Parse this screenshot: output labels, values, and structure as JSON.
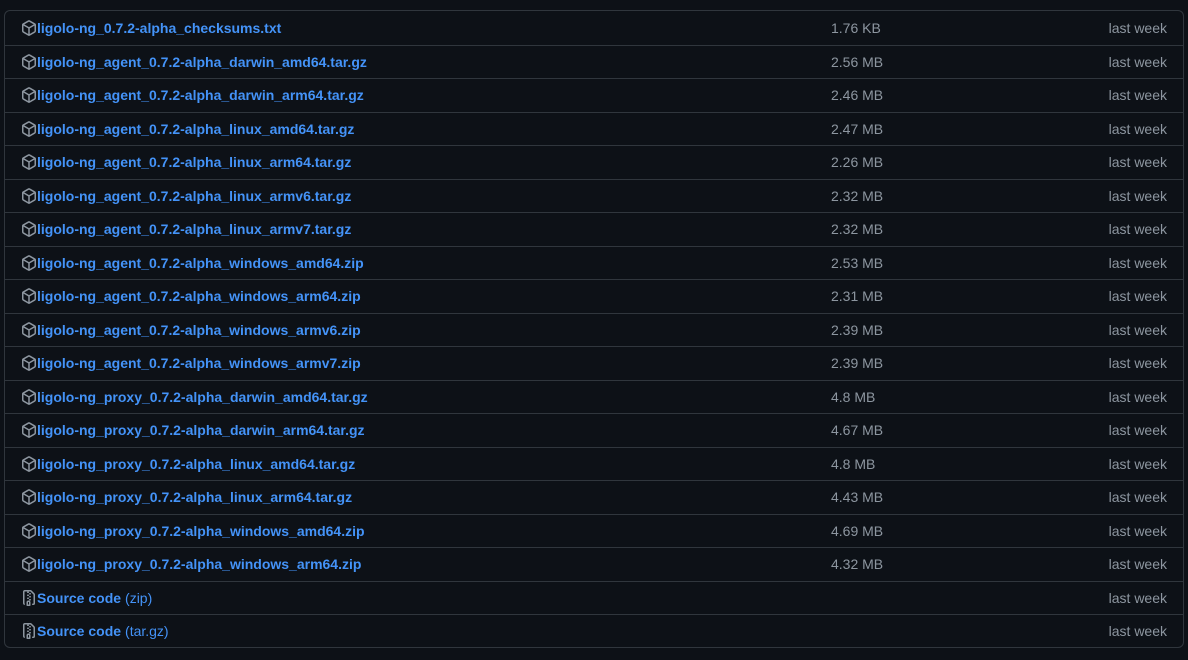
{
  "assets": [
    {
      "name": "ligolo-ng_0.7.2-alpha_checksums.txt",
      "size": "1.76 KB",
      "date": "last week",
      "icon": "package-icon"
    },
    {
      "name": "ligolo-ng_agent_0.7.2-alpha_darwin_amd64.tar.gz",
      "size": "2.56 MB",
      "date": "last week",
      "icon": "package-icon"
    },
    {
      "name": "ligolo-ng_agent_0.7.2-alpha_darwin_arm64.tar.gz",
      "size": "2.46 MB",
      "date": "last week",
      "icon": "package-icon"
    },
    {
      "name": "ligolo-ng_agent_0.7.2-alpha_linux_amd64.tar.gz",
      "size": "2.47 MB",
      "date": "last week",
      "icon": "package-icon"
    },
    {
      "name": "ligolo-ng_agent_0.7.2-alpha_linux_arm64.tar.gz",
      "size": "2.26 MB",
      "date": "last week",
      "icon": "package-icon"
    },
    {
      "name": "ligolo-ng_agent_0.7.2-alpha_linux_armv6.tar.gz",
      "size": "2.32 MB",
      "date": "last week",
      "icon": "package-icon"
    },
    {
      "name": "ligolo-ng_agent_0.7.2-alpha_linux_armv7.tar.gz",
      "size": "2.32 MB",
      "date": "last week",
      "icon": "package-icon"
    },
    {
      "name": "ligolo-ng_agent_0.7.2-alpha_windows_amd64.zip",
      "size": "2.53 MB",
      "date": "last week",
      "icon": "package-icon"
    },
    {
      "name": "ligolo-ng_agent_0.7.2-alpha_windows_arm64.zip",
      "size": "2.31 MB",
      "date": "last week",
      "icon": "package-icon"
    },
    {
      "name": "ligolo-ng_agent_0.7.2-alpha_windows_armv6.zip",
      "size": "2.39 MB",
      "date": "last week",
      "icon": "package-icon"
    },
    {
      "name": "ligolo-ng_agent_0.7.2-alpha_windows_armv7.zip",
      "size": "2.39 MB",
      "date": "last week",
      "icon": "package-icon"
    },
    {
      "name": "ligolo-ng_proxy_0.7.2-alpha_darwin_amd64.tar.gz",
      "size": "4.8 MB",
      "date": "last week",
      "icon": "package-icon"
    },
    {
      "name": "ligolo-ng_proxy_0.7.2-alpha_darwin_arm64.tar.gz",
      "size": "4.67 MB",
      "date": "last week",
      "icon": "package-icon"
    },
    {
      "name": "ligolo-ng_proxy_0.7.2-alpha_linux_amd64.tar.gz",
      "size": "4.8 MB",
      "date": "last week",
      "icon": "package-icon"
    },
    {
      "name": "ligolo-ng_proxy_0.7.2-alpha_linux_arm64.tar.gz",
      "size": "4.43 MB",
      "date": "last week",
      "icon": "package-icon"
    },
    {
      "name": "ligolo-ng_proxy_0.7.2-alpha_windows_amd64.zip",
      "size": "4.69 MB",
      "date": "last week",
      "icon": "package-icon"
    },
    {
      "name": "ligolo-ng_proxy_0.7.2-alpha_windows_arm64.zip",
      "size": "4.32 MB",
      "date": "last week",
      "icon": "package-icon"
    }
  ],
  "source_code": [
    {
      "name": "Source code",
      "suffix": "(zip)",
      "date": "last week",
      "icon": "file-zip-icon"
    },
    {
      "name": "Source code",
      "suffix": "(tar.gz)",
      "date": "last week",
      "icon": "file-zip-icon"
    }
  ],
  "colors": {
    "background": "#0d1117",
    "border": "#30363d",
    "link": "#4493f8",
    "muted": "#8d96a0"
  }
}
